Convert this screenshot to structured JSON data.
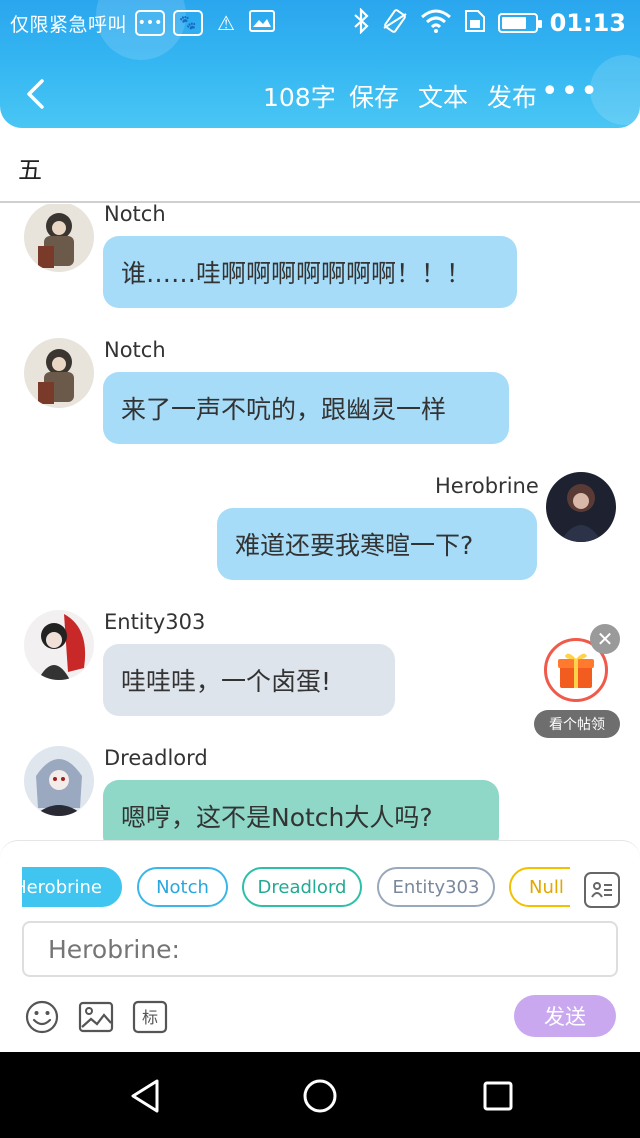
{
  "status_bar": {
    "carrier": "仅限紧急呼叫",
    "time": "01:13",
    "battery_level": 0.75,
    "icons": [
      "message-icon",
      "paw-icon",
      "warning-icon",
      "image-icon",
      "bluetooth-icon",
      "vibrate-icon",
      "wifi-icon",
      "sim-icon",
      "battery-icon"
    ]
  },
  "toolbar": {
    "word_count": "108字",
    "save": "保存",
    "text": "文本",
    "publish": "发布",
    "more": "•••"
  },
  "chapter": {
    "title": "五"
  },
  "messages": [
    {
      "speaker": "Notch",
      "text": "谁……哇啊啊啊啊啊啊啊！！！",
      "side": "left",
      "color": "#a6dcf8"
    },
    {
      "speaker": "Notch",
      "text": "来了一声不吭的，跟幽灵一样",
      "side": "left",
      "color": "#a6dcf8"
    },
    {
      "speaker": "Herobrine",
      "text": "难道还要我寒暄一下?",
      "side": "right",
      "color": "#a6dcf8"
    },
    {
      "speaker": "Entity303",
      "text": "哇哇哇，一个卤蛋!",
      "side": "left",
      "color": "#dde4ec"
    },
    {
      "speaker": "Dreadlord",
      "text": "嗯哼，这不是Notch大人吗?",
      "side": "left",
      "color": "#8fd8c8"
    }
  ],
  "gift": {
    "label": "看个帖领",
    "close": "✕"
  },
  "characters": [
    "Herobrine",
    "Notch",
    "Dreadlord",
    "Entity303",
    "Null"
  ],
  "selected_character": "Herobrine",
  "input": {
    "placeholder": "Herobrine:"
  },
  "send_label": "发送"
}
